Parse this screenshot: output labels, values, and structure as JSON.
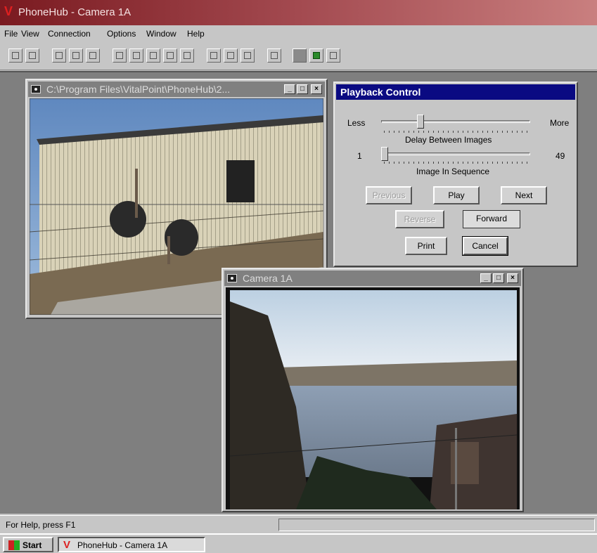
{
  "app": {
    "title": "PhoneHub - Camera 1A",
    "logo_icon": "phonehub-v-icon"
  },
  "menu": [
    "File",
    "View",
    "Connection",
    "Options",
    "Window",
    "Help"
  ],
  "toolbar": {
    "buttons": [
      "open-icon",
      "save-icon",
      "snapshot-icon",
      "help-icon",
      "context-help-icon",
      "camera1-icon",
      "camera2-icon",
      "camera3-icon",
      "camera4-icon",
      "camera5-icon",
      "query-icon",
      "grid-icon",
      "grid2-icon",
      "phone-icon",
      "stop-icon",
      "monitor-icon",
      "network-icon"
    ]
  },
  "image_window": {
    "title": "C:\\Program Files\\VitalPoint\\PhoneHub\\2..."
  },
  "camera_window": {
    "title": "Camera 1A"
  },
  "playback": {
    "title": "Playback Control",
    "delay": {
      "min_label": "Less",
      "max_label": "More",
      "caption": "Delay Between Images",
      "level": 0.25
    },
    "sequence": {
      "min_label": "1",
      "max_label": "49",
      "caption": "Image In Sequence",
      "value": 1
    },
    "buttons": {
      "previous": "Previous",
      "play": "Play",
      "next": "Next",
      "reverse": "Reverse",
      "forward": "Forward",
      "print": "Print",
      "cancel": "Cancel"
    }
  },
  "status": {
    "text": "For Help, press F1"
  },
  "taskbar": {
    "start": "Start",
    "task": "PhoneHub - Camera 1A"
  },
  "colors": {
    "title_active": "#0a0a82",
    "title_inactive": "#808080",
    "desktop": "#7f7f7f"
  }
}
